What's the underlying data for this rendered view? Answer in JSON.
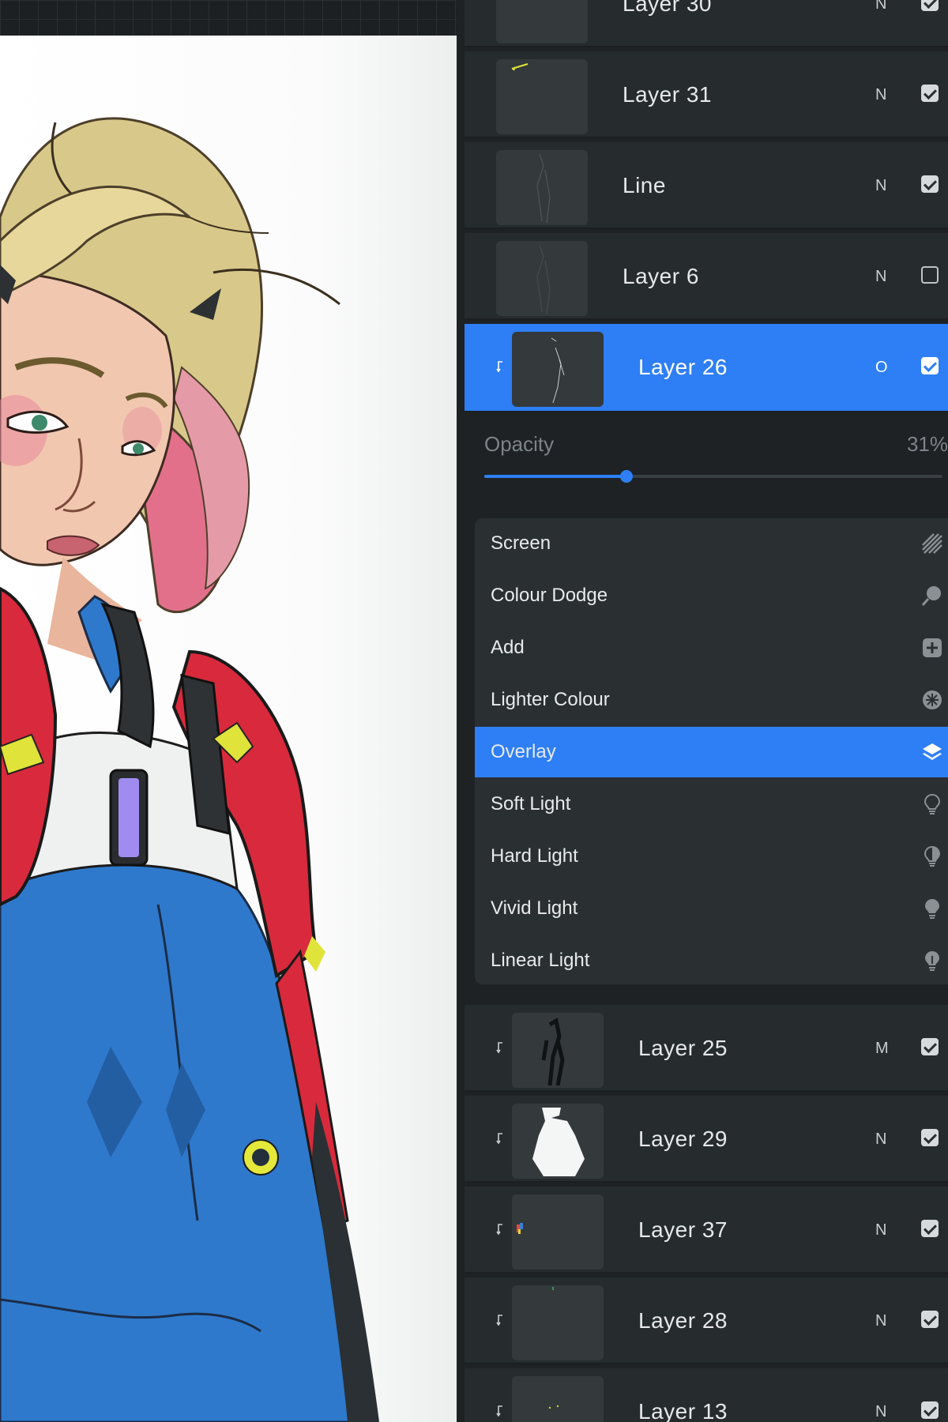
{
  "layers_top": [
    {
      "name": "Layer 30",
      "blend": "N",
      "visible": true,
      "clipped": false
    },
    {
      "name": "Layer 31",
      "blend": "N",
      "visible": true,
      "clipped": false
    },
    {
      "name": "Line",
      "blend": "N",
      "visible": true,
      "clipped": false
    },
    {
      "name": "Layer 6",
      "blend": "N",
      "visible": false,
      "clipped": false
    },
    {
      "name": "Layer 26",
      "blend": "O",
      "visible": true,
      "clipped": true,
      "selected": true
    }
  ],
  "opacity": {
    "label": "Opacity",
    "value_text": "31%",
    "value": 0.31
  },
  "blend_modes": [
    {
      "label": "Screen",
      "icon": "screen-hatch-icon"
    },
    {
      "label": "Colour Dodge",
      "icon": "colour-dodge-icon"
    },
    {
      "label": "Add",
      "icon": "add-plus-icon"
    },
    {
      "label": "Lighter Colour",
      "icon": "lighter-colour-icon"
    },
    {
      "label": "Overlay",
      "icon": "overlay-layers-icon",
      "selected": true
    },
    {
      "label": "Soft Light",
      "icon": "soft-light-bulb-icon"
    },
    {
      "label": "Hard Light",
      "icon": "hard-light-bulb-icon"
    },
    {
      "label": "Vivid Light",
      "icon": "vivid-light-bulb-icon"
    },
    {
      "label": "Linear Light",
      "icon": "linear-light-bulb-icon"
    }
  ],
  "layers_bottom": [
    {
      "name": "Layer 25",
      "blend": "M",
      "visible": true,
      "clipped": true
    },
    {
      "name": "Layer 29",
      "blend": "N",
      "visible": true,
      "clipped": true
    },
    {
      "name": "Layer 37",
      "blend": "N",
      "visible": true,
      "clipped": true
    },
    {
      "name": "Layer 28",
      "blend": "N",
      "visible": true,
      "clipped": true
    },
    {
      "name": "Layer 13",
      "blend": "N",
      "visible": true,
      "clipped": true
    }
  ],
  "colors": {
    "accent": "#2e7ff5",
    "panel_bg": "#1e2224",
    "row_bg": "#262b2e",
    "menu_bg": "#2a2f32"
  }
}
